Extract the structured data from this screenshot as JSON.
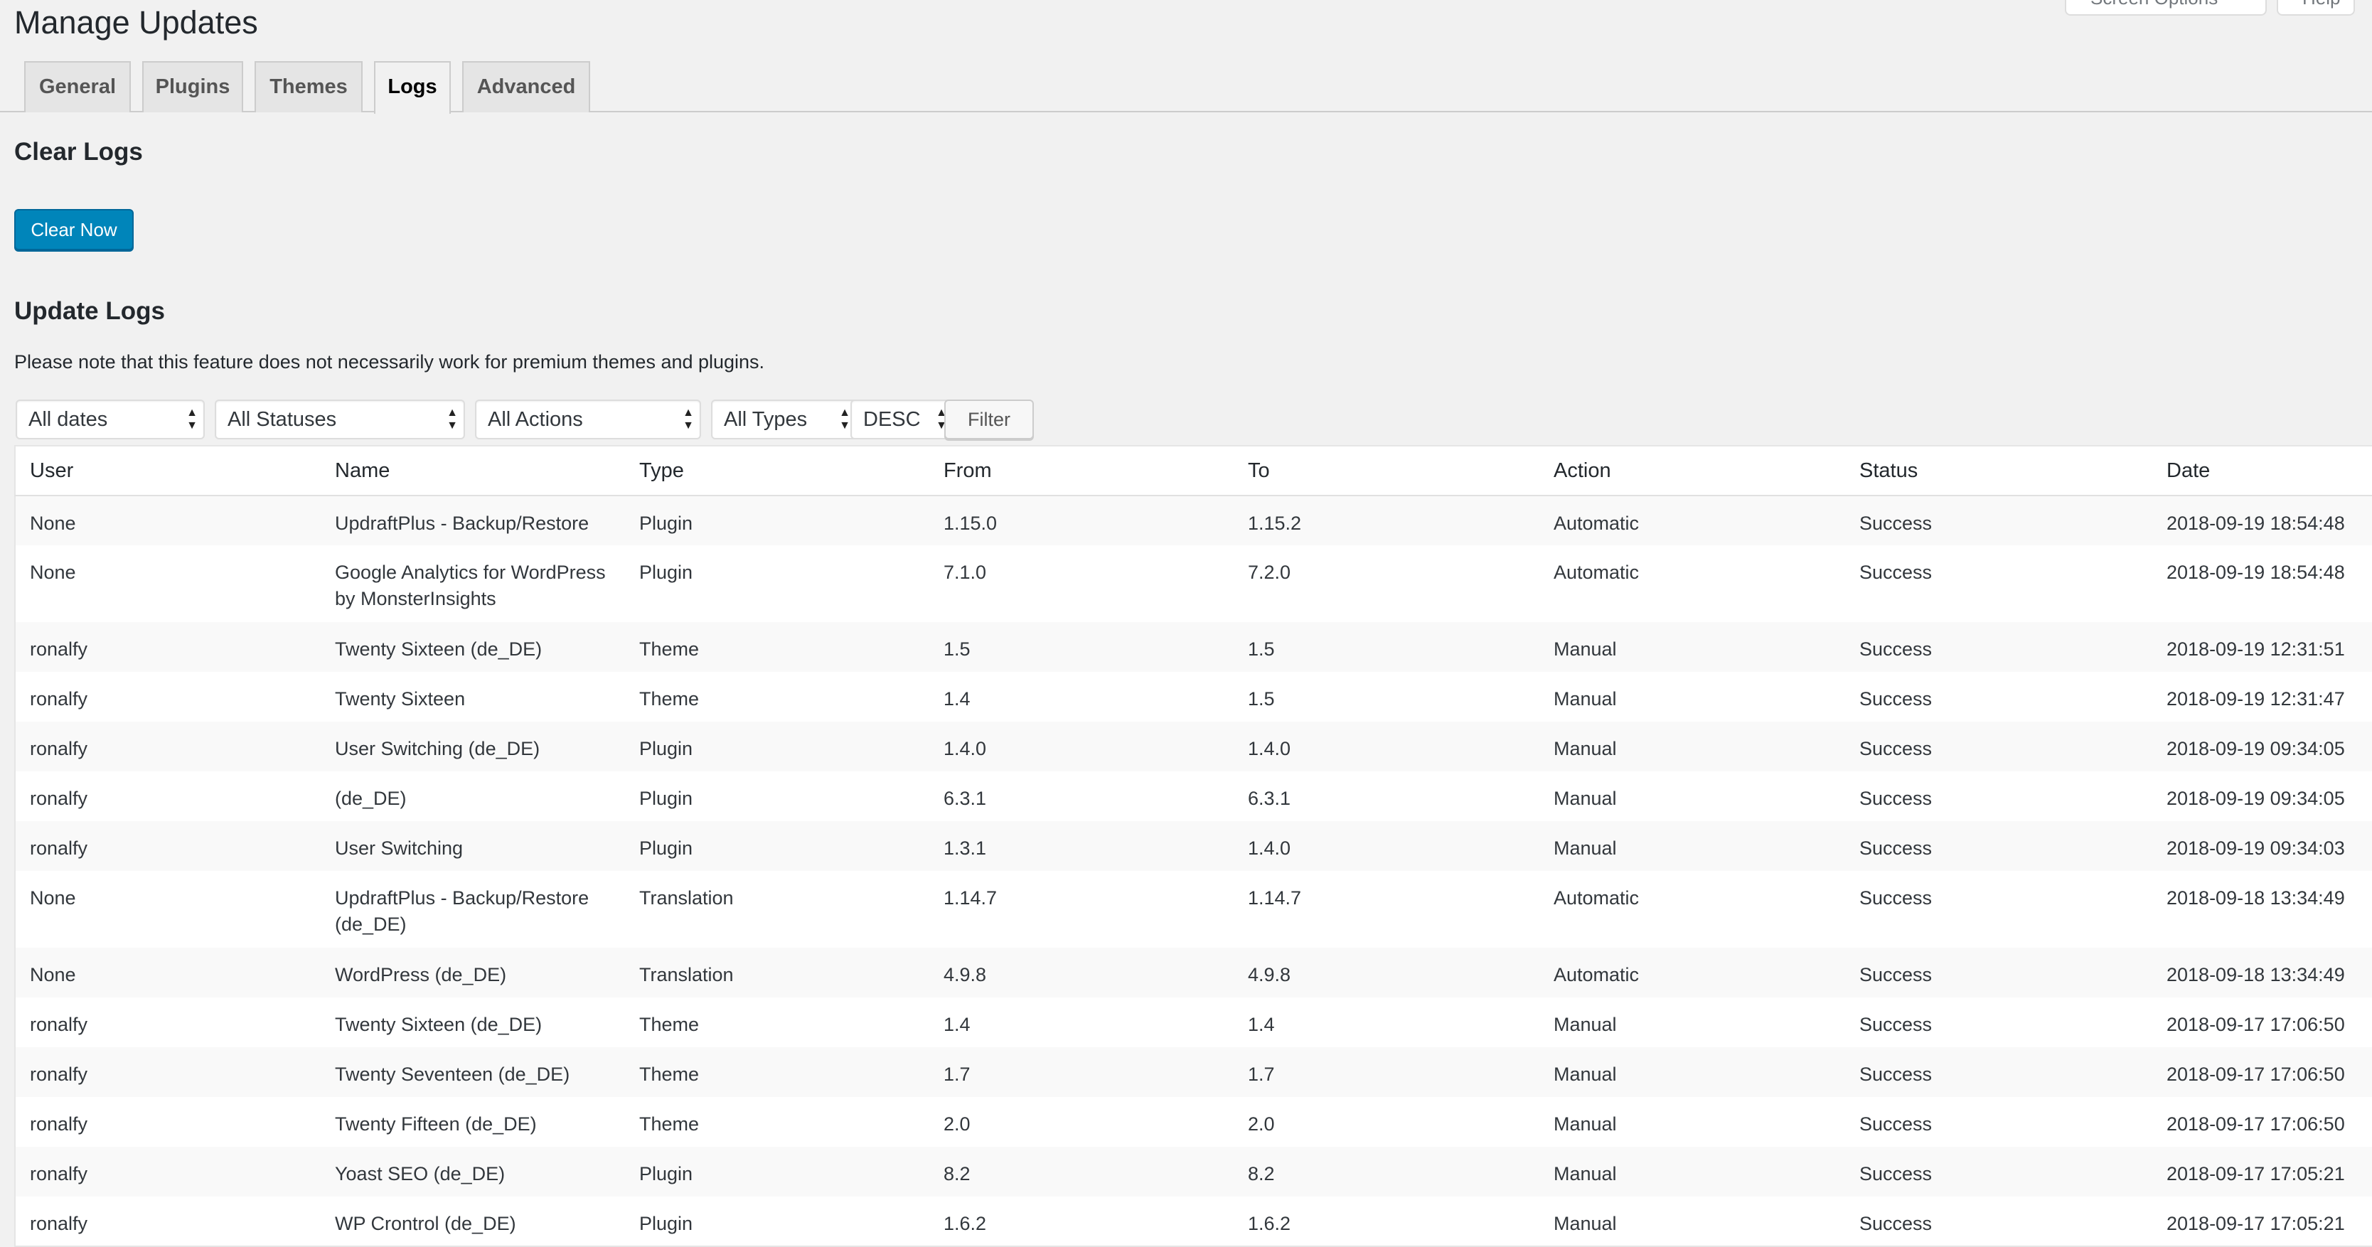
{
  "page": {
    "title": "Manage Updates",
    "screen_options": "Screen Options",
    "help": "Help"
  },
  "tabs": [
    {
      "label": "General"
    },
    {
      "label": "Plugins"
    },
    {
      "label": "Themes"
    },
    {
      "label": "Logs",
      "active": true
    },
    {
      "label": "Advanced"
    }
  ],
  "clear_section": {
    "title": "Clear Logs",
    "button_label": "Clear Now"
  },
  "logs_section": {
    "title": "Update Logs",
    "note": "Please note that this feature does not necessarily work for premium themes and plugins."
  },
  "filters": {
    "dates": "All dates",
    "statuses": "All Statuses",
    "actions": "All Actions",
    "types": "All Types",
    "order": "DESC",
    "filter_button": "Filter"
  },
  "table": {
    "columns": [
      "User",
      "Name",
      "Type",
      "From",
      "To",
      "Action",
      "Status",
      "Date"
    ],
    "rows": [
      [
        "None",
        "UpdraftPlus - Backup/Restore",
        "Plugin",
        "1.15.0",
        "1.15.2",
        "Automatic",
        "Success",
        "2018-09-19 18:54:48"
      ],
      [
        "None",
        "Google Analytics for WordPress by MonsterInsights",
        "Plugin",
        "7.1.0",
        "7.2.0",
        "Automatic",
        "Success",
        "2018-09-19 18:54:48"
      ],
      [
        "ronalfy",
        "Twenty Sixteen (de_DE)",
        "Theme",
        "1.5",
        "1.5",
        "Manual",
        "Success",
        "2018-09-19 12:31:51"
      ],
      [
        "ronalfy",
        "Twenty Sixteen",
        "Theme",
        "1.4",
        "1.5",
        "Manual",
        "Success",
        "2018-09-19 12:31:47"
      ],
      [
        "ronalfy",
        "User Switching (de_DE)",
        "Plugin",
        "1.4.0",
        "1.4.0",
        "Manual",
        "Success",
        "2018-09-19 09:34:05"
      ],
      [
        "ronalfy",
        "(de_DE)",
        "Plugin",
        "6.3.1",
        "6.3.1",
        "Manual",
        "Success",
        "2018-09-19 09:34:05"
      ],
      [
        "ronalfy",
        "User Switching",
        "Plugin",
        "1.3.1",
        "1.4.0",
        "Manual",
        "Success",
        "2018-09-19 09:34:03"
      ],
      [
        "None",
        "UpdraftPlus - Backup/Restore (de_DE)",
        "Translation",
        "1.14.7",
        "1.14.7",
        "Automatic",
        "Success",
        "2018-09-18 13:34:49"
      ],
      [
        "None",
        "WordPress (de_DE)",
        "Translation",
        "4.9.8",
        "4.9.8",
        "Automatic",
        "Success",
        "2018-09-18 13:34:49"
      ],
      [
        "ronalfy",
        "Twenty Sixteen (de_DE)",
        "Theme",
        "1.4",
        "1.4",
        "Manual",
        "Success",
        "2018-09-17 17:06:50"
      ],
      [
        "ronalfy",
        "Twenty Seventeen (de_DE)",
        "Theme",
        "1.7",
        "1.7",
        "Manual",
        "Success",
        "2018-09-17 17:06:50"
      ],
      [
        "ronalfy",
        "Twenty Fifteen (de_DE)",
        "Theme",
        "2.0",
        "2.0",
        "Manual",
        "Success",
        "2018-09-17 17:06:50"
      ],
      [
        "ronalfy",
        "Yoast SEO (de_DE)",
        "Plugin",
        "8.2",
        "8.2",
        "Manual",
        "Success",
        "2018-09-17 17:05:21"
      ],
      [
        "ronalfy",
        "WP Crontrol (de_DE)",
        "Plugin",
        "1.6.2",
        "1.6.2",
        "Manual",
        "Success",
        "2018-09-17 17:05:21"
      ]
    ]
  }
}
